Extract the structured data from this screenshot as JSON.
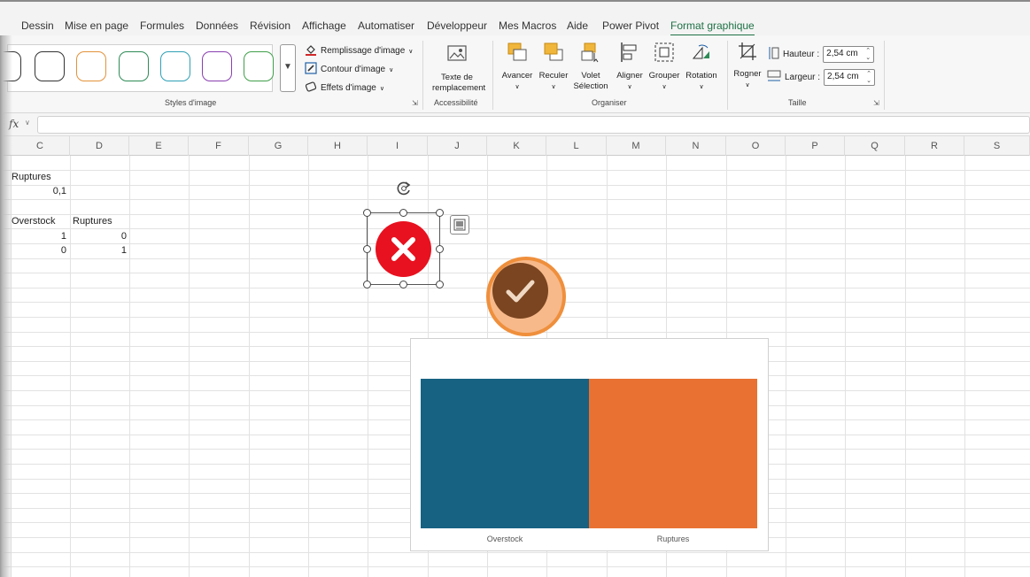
{
  "menu": {
    "tabs": [
      "Dessin",
      "Mise en page",
      "Formules",
      "Données",
      "Révision",
      "Affichage",
      "Automatiser",
      "Développeur",
      "Mes Macros",
      "Aide",
      "Power Pivot",
      "Format graphique"
    ],
    "active_tab": "Format graphique"
  },
  "ribbon": {
    "styles_group": {
      "label": "Styles d'image",
      "thumb_colors": [
        "#3f5fa8",
        "#3f5fa8",
        "#e3923a",
        "#2e8b57",
        "#2fa0b5",
        "#8a3fb0",
        "#3f9f4a"
      ]
    },
    "fill_label": "Remplissage d'image",
    "outline_label": "Contour d'image",
    "effects_label": "Effets d'image",
    "alt_text": {
      "line1": "Texte de",
      "line2": "remplacement",
      "group": "Accessibilité"
    },
    "arrange": {
      "group": "Organiser",
      "avancer": "Avancer",
      "reculer": "Reculer",
      "volet_line1": "Volet",
      "volet_line2": "Sélection",
      "aligner": "Aligner",
      "grouper": "Grouper",
      "rotation": "Rotation"
    },
    "size": {
      "group": "Taille",
      "rogner": "Rogner",
      "hauteur_label": "Hauteur :",
      "hauteur_value": "2,54 cm",
      "largeur_label": "Largeur :",
      "largeur_value": "2,54 cm"
    }
  },
  "formula_bar": {
    "fx": "fx",
    "value": ""
  },
  "columns": [
    "C",
    "D",
    "E",
    "F",
    "G",
    "H",
    "I",
    "J",
    "K",
    "L",
    "M",
    "N",
    "O",
    "P",
    "Q",
    "R",
    "S"
  ],
  "cells": {
    "c_ruptures": "Ruptures",
    "c_value": "0,1",
    "c_overstock": "Overstock",
    "d_ruptures": "Ruptures",
    "r1_c": "1",
    "r1_d": "0",
    "r2_c": "0",
    "r2_d": "1"
  },
  "chart_data": {
    "type": "bar",
    "categories": [
      "Overstock",
      "Ruptures"
    ],
    "series": [
      {
        "values": [
          1,
          1
        ],
        "colors": [
          "#176283",
          "#e97132"
        ]
      }
    ],
    "title": "",
    "xlabel": "",
    "ylabel": "",
    "ylim": [
      0,
      1
    ],
    "grid": false,
    "legend": "none"
  },
  "colors": {
    "accent_green": "#1e7145",
    "x_red": "#e8111f",
    "check_brown": "#7a4520",
    "check_orange": "#ef8f3c"
  }
}
